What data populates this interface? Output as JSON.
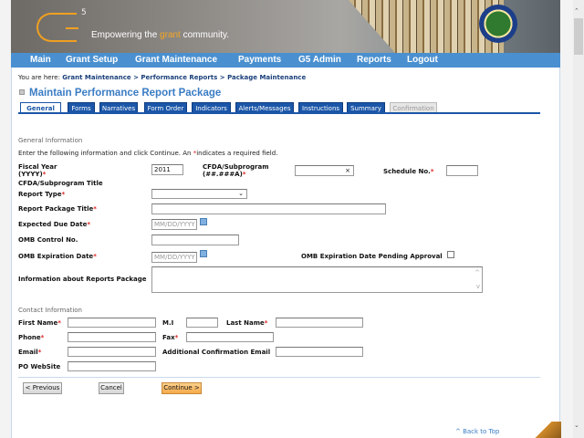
{
  "header": {
    "tagline_pre": "Empowering the ",
    "tagline_accent": "grant",
    "tagline_post": " community.",
    "logo_sup": "5",
    "logo_text": "G",
    "accent": "#f5a623"
  },
  "nav": [
    "Main",
    "Grant Setup",
    "Grant Maintenance",
    "Payments",
    "G5 Admin",
    "Reports",
    "Logout"
  ],
  "breadcrumb": {
    "prefix": "You are here: ",
    "items": [
      "Grant Maintenance",
      "Performance Reports",
      "Package Maintenance"
    ],
    "sep": " > "
  },
  "page_title": "Maintain Performance Report Package",
  "tabs": [
    {
      "label": "General",
      "state": "active"
    },
    {
      "label": "Forms"
    },
    {
      "label": "Narratives"
    },
    {
      "label": "Form Order"
    },
    {
      "label": "Indicators"
    },
    {
      "label": "Alerts/Messages"
    },
    {
      "label": "Instructions"
    },
    {
      "label": "Summary"
    },
    {
      "label": "Confirmation",
      "state": "disabled"
    }
  ],
  "general": {
    "heading": "General Information",
    "instructions_pre": "Enter the following information and click Continue.  An ",
    "instructions_post": "indicates a required field.",
    "fiscal_year_label": "Fiscal Year (YYYY)",
    "fiscal_year_value": "2011",
    "cfda_label": "CFDA/Subprogram (##.###A)",
    "cfda_value": "",
    "cfda_clear": "×",
    "schedule_label": "Schedule No.",
    "schedule_value": "",
    "cfda_title_label": "CFDA/Subprogram Title",
    "report_type_label": "Report Type",
    "report_type_value": "",
    "package_title_label": "Report Package Title",
    "due_date_label": "Expected Due Date",
    "date_placeholder": "MM/DD/YYYY",
    "omb_control_label": "OMB Control No.",
    "omb_exp_label": "OMB Expiration Date",
    "omb_pending_label": "OMB Expiration Date Pending Approval",
    "omb_pending_checked": false,
    "info_label": "Information about Reports Package"
  },
  "contact": {
    "heading": "Contact Information",
    "first_name": "First Name",
    "mi": "M.I",
    "last_name": "Last Name",
    "phone": "Phone",
    "fax": "Fax",
    "email": "Email",
    "add_email": "Additional Confirmation Email",
    "website": "PO WebSite"
  },
  "buttons": {
    "previous": "< Previous",
    "cancel": "Cancel",
    "continue": "Continue >"
  },
  "back_to_top": "^ Back to Top",
  "req_mark": "*"
}
